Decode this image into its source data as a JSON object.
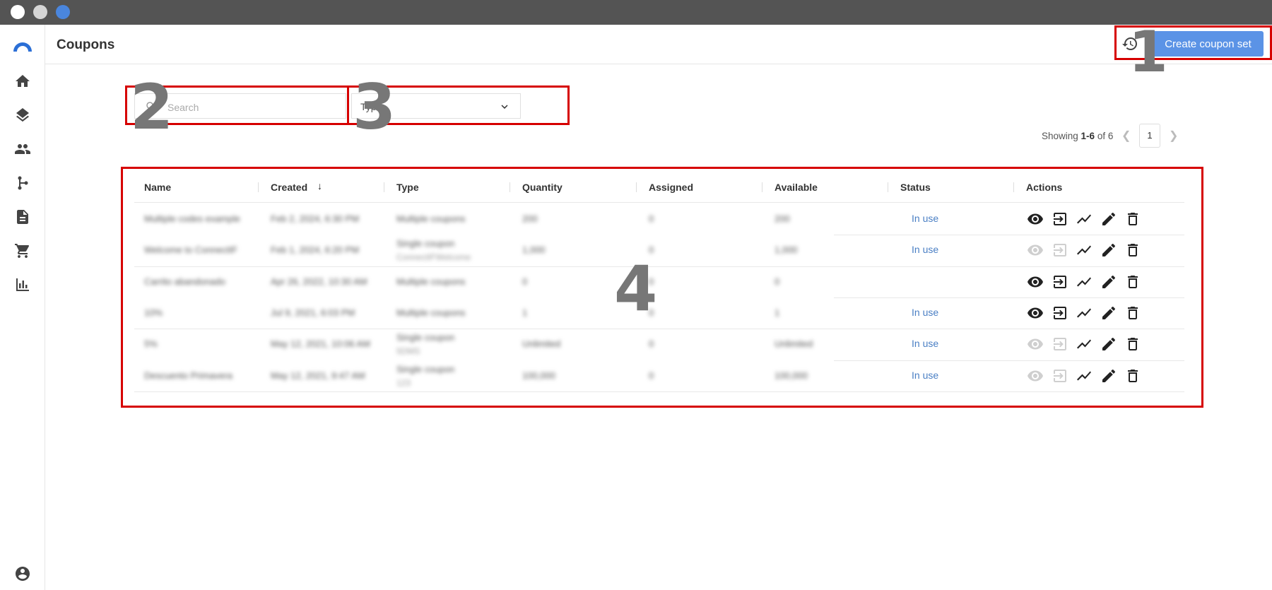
{
  "window": {
    "dots": [
      "#ffffff",
      "#d5d5d5",
      "#4a86de"
    ]
  },
  "sidebar": {
    "items": [
      "logo",
      "home",
      "layers",
      "people",
      "flow",
      "document",
      "cart",
      "chart",
      "account"
    ]
  },
  "header": {
    "title": "Coupons",
    "create_label": "Create coupon set",
    "accent": "#5b93e6"
  },
  "annotations": [
    "1",
    "2",
    "3",
    "4"
  ],
  "filters": {
    "search_placeholder": "Search",
    "type_label": "Type"
  },
  "pagination": {
    "prefix": "Showing ",
    "range": "1-6",
    "suffix": " of 6",
    "page": "1"
  },
  "table": {
    "headers": [
      "Name",
      "Created",
      "Type",
      "Quantity",
      "Assigned",
      "Available",
      "Status",
      "Actions"
    ],
    "sorted_column": "Created",
    "rows": [
      {
        "name": "Multiple codes example",
        "created": "Feb 2, 2024, 6:30 PM",
        "type": "Multiple coupons",
        "type_sub": "",
        "quantity": "200",
        "assigned": "0",
        "available": "200",
        "status": "In use",
        "view_enabled": true
      },
      {
        "name": "Welcome to ConnectIF",
        "created": "Feb 1, 2024, 6:20 PM",
        "type": "Single coupon",
        "type_sub": "ConnectIFWelcome",
        "quantity": "1,000",
        "assigned": "0",
        "available": "1,000",
        "status": "In use",
        "view_enabled": false
      },
      {
        "name": "Carrito abandonado",
        "created": "Apr 26, 2022, 10:30 AM",
        "type": "Multiple coupons",
        "type_sub": "",
        "quantity": "0",
        "assigned": "0",
        "available": "0",
        "status": "",
        "view_enabled": true
      },
      {
        "name": "10%",
        "created": "Jul 9, 2021, 6:03 PM",
        "type": "Multiple coupons",
        "type_sub": "",
        "quantity": "1",
        "assigned": "0",
        "available": "1",
        "status": "In use",
        "view_enabled": true
      },
      {
        "name": "5%",
        "created": "May 12, 2021, 10:06 AM",
        "type": "Single coupon",
        "type_sub": "5DMS",
        "quantity": "Unlimited",
        "assigned": "0",
        "available": "Unlimited",
        "status": "In use",
        "view_enabled": false
      },
      {
        "name": "Descuento Primavera",
        "created": "May 12, 2021, 9:47 AM",
        "type": "Single coupon",
        "type_sub": "123",
        "quantity": "100,000",
        "assigned": "0",
        "available": "100,000",
        "status": "In use",
        "view_enabled": false
      }
    ]
  }
}
